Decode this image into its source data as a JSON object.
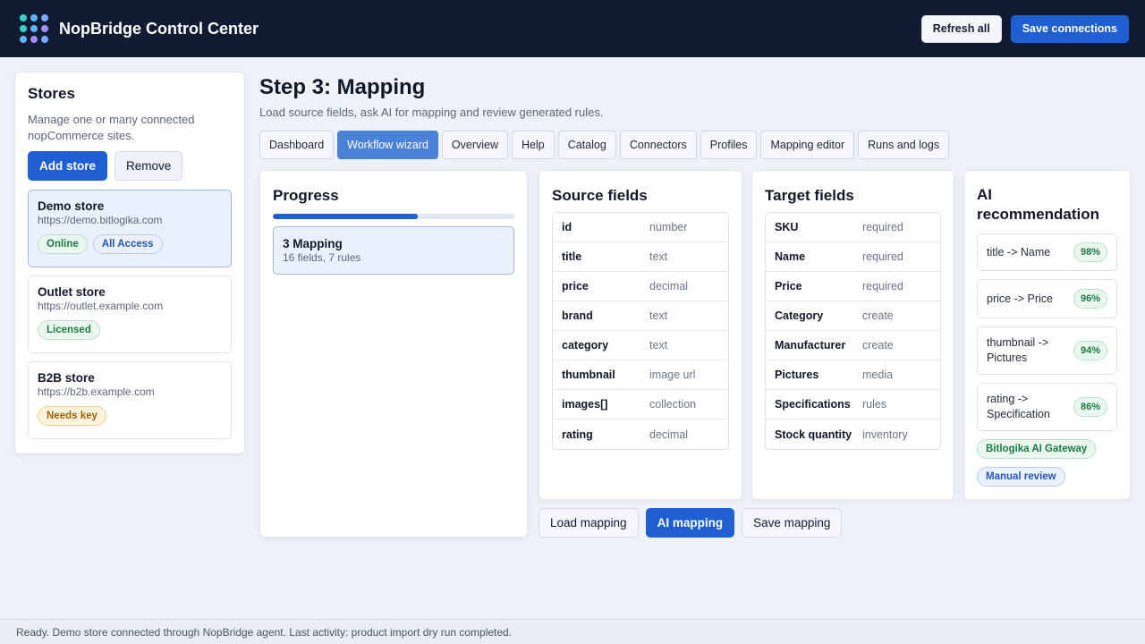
{
  "header": {
    "title": "NopBridge Control Center",
    "refresh_label": "Refresh all",
    "save_label": "Save connections",
    "logo_colors": [
      "#3ad1c5",
      "#5fb2ff",
      "#7aa8ff",
      "#3ad1c5",
      "#5fb2ff",
      "#a18bff",
      "#5fb2ff",
      "#a18bff",
      "#7aa8ff"
    ]
  },
  "stores": {
    "title": "Stores",
    "description": "Manage one or many connected nopCommerce sites.",
    "add_label": "Add store",
    "remove_label": "Remove",
    "items": [
      {
        "name": "Demo store",
        "url": "https://demo.bitlogika.com",
        "badges": [
          "Online",
          "All Access"
        ]
      },
      {
        "name": "Outlet store",
        "url": "https://outlet.example.com",
        "badges": [
          "Licensed"
        ]
      },
      {
        "name": "B2B store",
        "url": "https://b2b.example.com",
        "badges": [
          "Needs key"
        ]
      }
    ]
  },
  "main": {
    "title": "Step 3: Mapping",
    "subtitle": "Load source fields, ask AI for mapping and review generated rules.",
    "tabs": [
      "Dashboard",
      "Workflow wizard",
      "Overview",
      "Help",
      "Catalog",
      "Connectors",
      "Profiles",
      "Mapping editor",
      "Runs and logs"
    ],
    "active_tab": "Workflow wizard"
  },
  "progress": {
    "title": "Progress",
    "fraction": 0.6,
    "step_title": "3 Mapping",
    "step_detail": "16 fields, 7 rules"
  },
  "source_fields": {
    "title": "Source fields",
    "rows": [
      {
        "name": "id",
        "type": "number"
      },
      {
        "name": "title",
        "type": "text"
      },
      {
        "name": "price",
        "type": "decimal"
      },
      {
        "name": "brand",
        "type": "text"
      },
      {
        "name": "category",
        "type": "text"
      },
      {
        "name": "thumbnail",
        "type": "image url"
      },
      {
        "name": "images[]",
        "type": "collection"
      },
      {
        "name": "rating",
        "type": "decimal"
      }
    ]
  },
  "target_fields": {
    "title": "Target fields",
    "rows": [
      {
        "name": "SKU",
        "type": "required"
      },
      {
        "name": "Name",
        "type": "required"
      },
      {
        "name": "Price",
        "type": "required"
      },
      {
        "name": "Category",
        "type": "create"
      },
      {
        "name": "Manufacturer",
        "type": "create"
      },
      {
        "name": "Pictures",
        "type": "media"
      },
      {
        "name": "Specifications",
        "type": "rules"
      },
      {
        "name": "Stock quantity",
        "type": "inventory"
      }
    ]
  },
  "ai": {
    "title": "AI recommendation",
    "recommendations": [
      {
        "text": "title -> Name",
        "confidence": "98%"
      },
      {
        "text": "price -> Price",
        "confidence": "96%"
      },
      {
        "text": "thumbnail -> Pictures",
        "confidence": "94%"
      },
      {
        "text": "rating -> Specification",
        "confidence": "86%"
      }
    ],
    "gateway_badge": "Bitlogika AI Gateway",
    "review_badge": "Manual review"
  },
  "actions": {
    "load_label": "Load mapping",
    "ai_label": "AI mapping",
    "save_label": "Save mapping"
  },
  "status": {
    "text": "Ready. Demo store connected through NopBridge agent. Last activity: product import dry run completed."
  }
}
